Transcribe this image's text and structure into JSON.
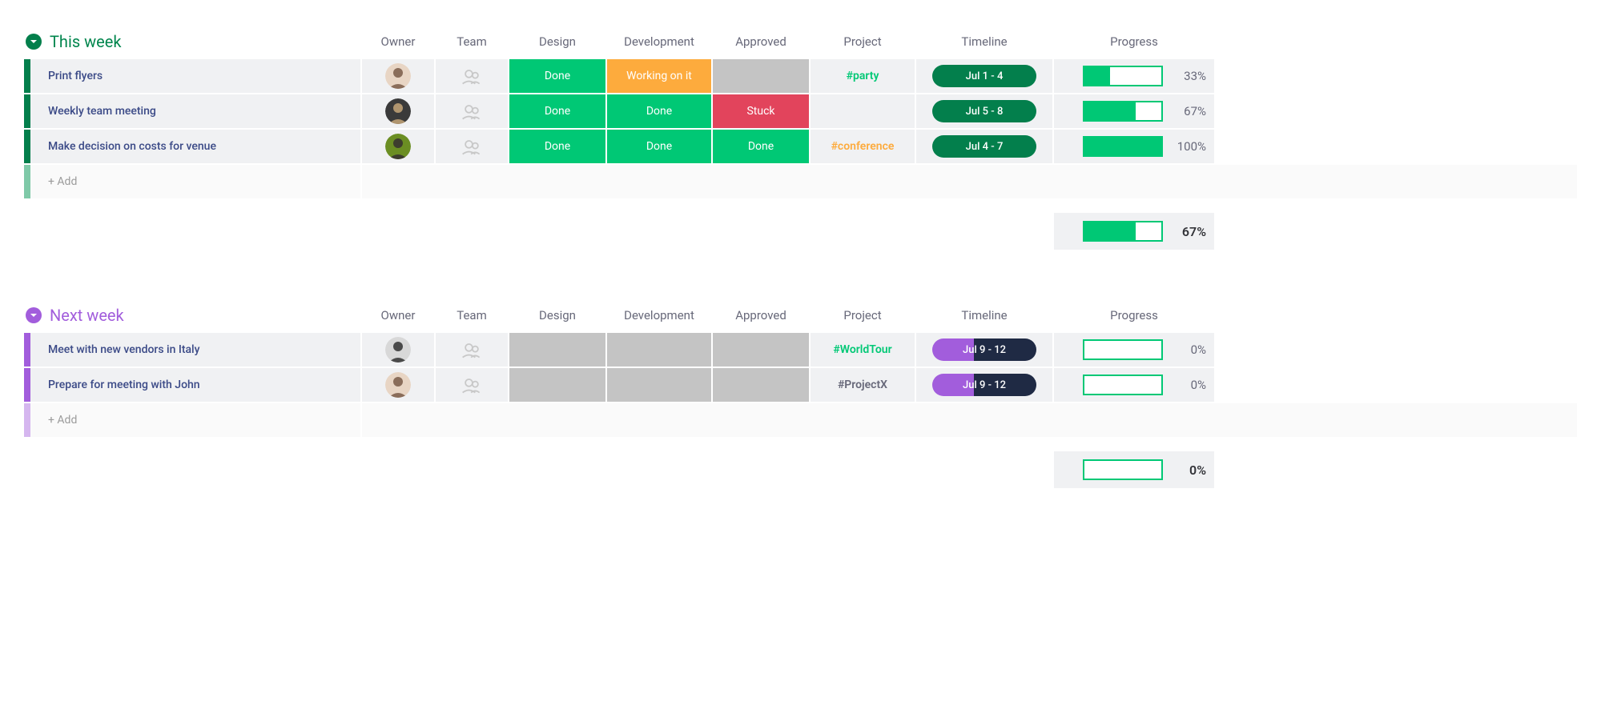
{
  "columns": {
    "owner": "Owner",
    "team": "Team",
    "design": "Design",
    "development": "Development",
    "approved": "Approved",
    "project": "Project",
    "timeline": "Timeline",
    "progress": "Progress"
  },
  "status_colors": {
    "done": "#00c875",
    "working": "#fdab3d",
    "stuck": "#e2445c",
    "empty": "#c4c4c4"
  },
  "status_labels": {
    "done": "Done",
    "working": "Working on it",
    "stuck": "Stuck"
  },
  "add_label": "+ Add",
  "groups": [
    {
      "id": "this-week",
      "title": "This week",
      "color": "#037f4c",
      "title_color": "#00854d",
      "bar_color": "#037f4c",
      "add_bar_color": "#7fc9a8",
      "rows": [
        {
          "task": "Print flyers",
          "owner_avatar": 1,
          "design": "done",
          "development": "working",
          "approved": "empty",
          "project": "#party",
          "project_color": "#00c875",
          "timeline_label": "Jul 1 - 4",
          "timeline_segments": [
            {
              "color": "#037f4c",
              "pct": 100
            }
          ],
          "progress": 33
        },
        {
          "task": "Weekly team meeting",
          "owner_avatar": 2,
          "design": "done",
          "development": "done",
          "approved": "stuck",
          "project": "",
          "project_color": "",
          "timeline_label": "Jul 5 - 8",
          "timeline_segments": [
            {
              "color": "#037f4c",
              "pct": 100
            }
          ],
          "progress": 67
        },
        {
          "task": "Make decision on costs for venue",
          "owner_avatar": 3,
          "design": "done",
          "development": "done",
          "approved": "done",
          "project": "#conference",
          "project_color": "#fdab3d",
          "timeline_label": "Jul 4 - 7",
          "timeline_segments": [
            {
              "color": "#037f4c",
              "pct": 100
            }
          ],
          "progress": 100
        }
      ],
      "summary_progress": 67
    },
    {
      "id": "next-week",
      "title": "Next week",
      "color": "#a25ddc",
      "title_color": "#a25ddc",
      "bar_color": "#a25ddc",
      "add_bar_color": "#d5b6ef",
      "rows": [
        {
          "task": "Meet with new vendors in Italy",
          "owner_avatar": 4,
          "design": "empty",
          "development": "empty",
          "approved": "empty",
          "project": "#WorldTour",
          "project_color": "#00c875",
          "timeline_label": "Jul 9 - 12",
          "timeline_segments": [
            {
              "color": "#a25ddc",
              "pct": 40
            },
            {
              "color": "#1f2a44",
              "pct": 60
            }
          ],
          "progress": 0
        },
        {
          "task": "Prepare for meeting with John",
          "owner_avatar": 1,
          "design": "empty",
          "development": "empty",
          "approved": "empty",
          "project": "#ProjectX",
          "project_color": "#676879",
          "timeline_label": "Jul 9 - 12",
          "timeline_segments": [
            {
              "color": "#a25ddc",
              "pct": 40
            },
            {
              "color": "#1f2a44",
              "pct": 60
            }
          ],
          "progress": 0
        }
      ],
      "summary_progress": 0
    }
  ]
}
